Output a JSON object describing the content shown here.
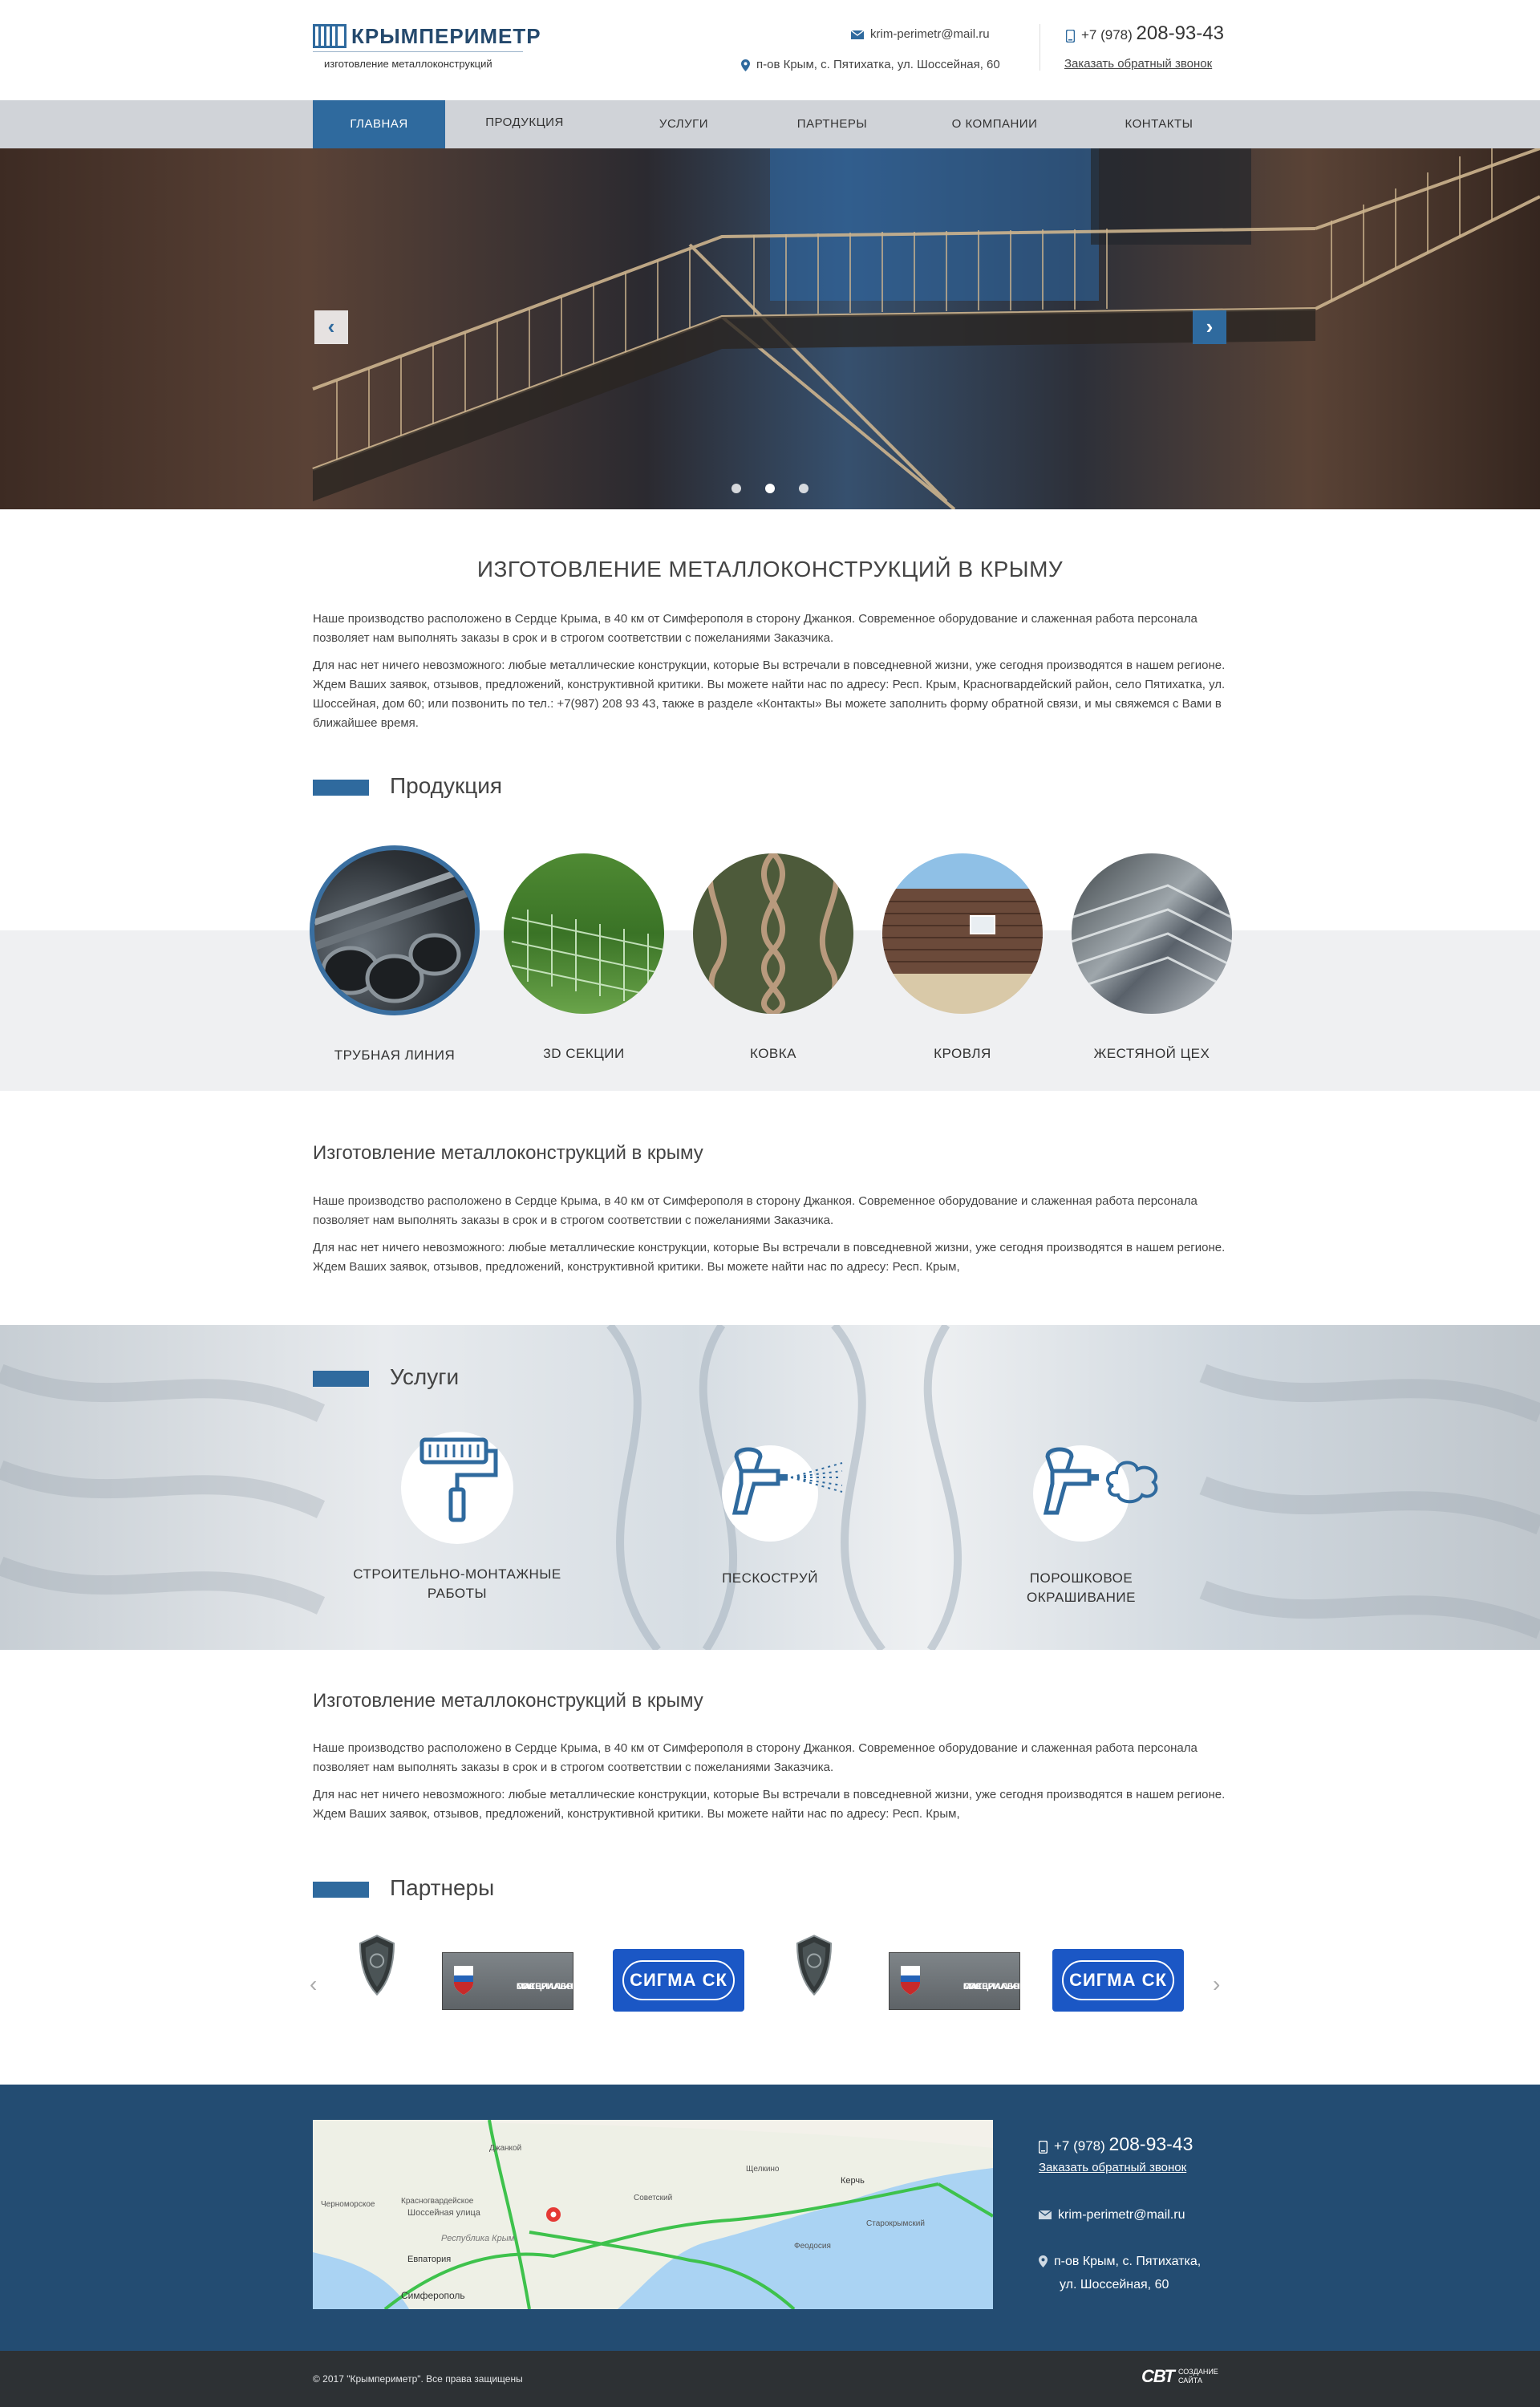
{
  "header": {
    "logo_name": "КРЫМПЕРИМЕТР",
    "logo_tagline": "изготовление металлоконструкций",
    "email": "krim-perimetr@mail.ru",
    "address": "п-ов Крым, с. Пятихатка, ул. Шоссейная, 60",
    "phone_prefix": "+7 (978)",
    "phone_number": "208-93-43",
    "callback": "Заказать обратный звонок"
  },
  "nav": [
    "ГЛАВНАЯ",
    "ПРОДУКЦИЯ",
    "УСЛУГИ",
    "ПАРТНЕРЫ",
    "О КОМПАНИИ",
    "КОНТАКТЫ"
  ],
  "intro": {
    "title": "ИЗГОТОВЛЕНИЕ МЕТАЛЛОКОНСТРУКЦИЙ В КРЫМУ",
    "p1": "Наше производство расположено в Сердце Крыма, в 40 км от Симферополя в сторону Джанкоя. Современное оборудование и слаженная работа персонала позволяет нам выполнять заказы в срок и в строгом соответствии с пожеланиями Заказчика.",
    "p2": "Для нас нет ничего невозможного: любые металлические конструкции, которые Вы встречали в повседневной жизни, уже сегодня производятся в нашем регионе. Ждем Ваших заявок, отзывов, предложений, конструктивной критики. Вы можете найти нас по адресу: Респ. Крым, Красногвардейский район, село Пятихатка, ул. Шоссейная, дом 60; или позвонить по тел.: +7(987) 208 93 43, также в разделе «Контакты» Вы можете заполнить форму обратной связи, и мы свяжемся с Вами в ближайшее время."
  },
  "products": {
    "title": "Продукция",
    "items": [
      "ТРУБНАЯ ЛИНИЯ",
      "3D СЕКЦИИ",
      "КОВКА",
      "КРОВЛЯ",
      "ЖЕСТЯНОЙ ЦЕХ"
    ]
  },
  "block2": {
    "title": "Изготовление металлоконструкций в крыму",
    "p1": "Наше производство расположено в Сердце Крыма, в 40 км от Симферополя в сторону Джанкоя. Современное оборудование и слаженная работа персонала позволяет нам выполнять заказы в срок и в строгом соответствии с пожеланиями Заказчика.",
    "p2": "Для нас нет ничего невозможного: любые металлические конструкции, которые Вы встречали в повседневной жизни, уже сегодня производятся в нашем регионе. Ждем Ваших заявок, отзывов, предложений, конструктивной критики. Вы можете найти нас по адресу: Респ. Крым,"
  },
  "services": {
    "title": "Услуги",
    "items": [
      {
        "line1": "СТРОИТЕЛЬНО-МОНТАЖНЫЕ",
        "line2": "РАБОТЫ",
        "icon": "paint-roller-icon"
      },
      {
        "line1": "ПЕСКОСТРУЙ",
        "line2": "",
        "icon": "sandblast-gun-icon"
      },
      {
        "line1": "ПОРОШКОВОЕ",
        "line2": "ОКРАШИВАНИЕ",
        "icon": "powder-spray-icon"
      }
    ]
  },
  "block3": {
    "title": "Изготовление металлоконструкций в крыму",
    "p1": "Наше производство расположено в Сердце Крыма, в 40 км от Симферополя в сторону Джанкоя. Современное оборудование и слаженная работа персонала позволяет нам выполнять заказы в срок и в строгом соответствии с пожеланиями Заказчика.",
    "p2": "Для нас нет ничего невозможного: любые металлические конструкции, которые Вы встречали в повседневной жизни, уже сегодня производятся в нашем регионе. Ждем Ваших заявок, отзывов, предложений, конструктивной критики. Вы можете найти нас по адресу: Респ. Крым,"
  },
  "partners": {
    "title": "Партнеры",
    "logos": [
      "shield-emblem",
      "гос специальных материалов",
      "СИГМА СК",
      "shield-emblem",
      "гос специальных материалов",
      "СИГМА СК"
    ],
    "sigma_text": "СИГМА СК",
    "gos_line1": "гос",
    "gos_line2": "специальных",
    "gos_line3": "материалов"
  },
  "map": {
    "labels": [
      "Евпатория",
      "Симферополь",
      "Шоссейная улица",
      "Красногвардейское",
      "Республика Крым",
      "Керчь",
      "Феодосия",
      "Джанкой",
      "Старокрымский",
      "Черноморское",
      "Советский",
      "Щелкино"
    ]
  },
  "footer": {
    "phone_prefix": "+7 (978)",
    "phone_number": "208-93-43",
    "callback": "Заказать обратный звонок",
    "email": "krim-perimetr@mail.ru",
    "address_line1": "п-ов Крым, с. Пятихатка,",
    "address_line2": "ул. Шоссейная, 60",
    "copyright": "© 2017 \"Крымпериметр\". Все права защищены",
    "dev_logo": "СВТ",
    "dev_text1": "СОЗДАНИЕ",
    "dev_text2": "САЙТА"
  },
  "colors": {
    "accent": "#2f6a9e",
    "footer": "#234c72",
    "nav": "#d0d3d8",
    "copy_bar": "#2d3134"
  }
}
